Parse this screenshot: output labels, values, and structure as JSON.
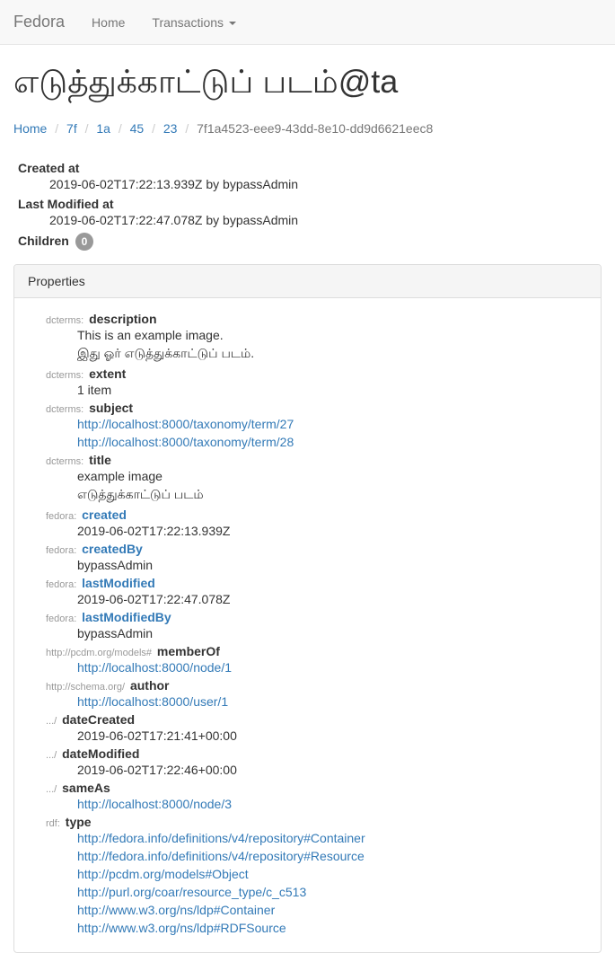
{
  "navbar": {
    "brand": "Fedora",
    "home": "Home",
    "transactions": "Transactions"
  },
  "page_title": "எடுத்துக்காட்டுப் படம்@ta",
  "breadcrumb": {
    "home": "Home",
    "seg1": "7f",
    "seg2": "1a",
    "seg3": "45",
    "seg4": "23",
    "active": "7f1a4523-eee9-43dd-8e10-dd9d6621eec8"
  },
  "meta": {
    "created_label": "Created at",
    "created_value": "2019-06-02T17:22:13.939Z by bypassAdmin",
    "modified_label": "Last Modified at",
    "modified_value": "2019-06-02T17:22:47.078Z by bypassAdmin",
    "children_label": "Children",
    "children_count": "0"
  },
  "panel": {
    "heading": "Properties"
  },
  "props": {
    "description": {
      "prefix": "dcterms:",
      "name": "description",
      "v1": "This is an example image.",
      "v2": "இது ஓர் எடுத்துக்காட்டுப் படம்."
    },
    "extent": {
      "prefix": "dcterms:",
      "name": "extent",
      "v1": "1 item"
    },
    "subject": {
      "prefix": "dcterms:",
      "name": "subject",
      "v1": "http://localhost:8000/taxonomy/term/27",
      "v2": "http://localhost:8000/taxonomy/term/28"
    },
    "title": {
      "prefix": "dcterms:",
      "name": "title",
      "v1": "example image",
      "v2": "எடுத்துக்காட்டுப் படம்"
    },
    "created": {
      "prefix": "fedora:",
      "name": "created",
      "v1": "2019-06-02T17:22:13.939Z"
    },
    "createdBy": {
      "prefix": "fedora:",
      "name": "createdBy",
      "v1": "bypassAdmin"
    },
    "lastModified": {
      "prefix": "fedora:",
      "name": "lastModified",
      "v1": "2019-06-02T17:22:47.078Z"
    },
    "lastModifiedBy": {
      "prefix": "fedora:",
      "name": "lastModifiedBy",
      "v1": "bypassAdmin"
    },
    "memberOf": {
      "prefix": "http://pcdm.org/models#",
      "name": "memberOf",
      "v1": "http://localhost:8000/node/1"
    },
    "author": {
      "prefix": "http://schema.org/",
      "name": "author",
      "v1": "http://localhost:8000/user/1"
    },
    "dateCreated": {
      "prefix": ".../",
      "name": "dateCreated",
      "v1": "2019-06-02T17:21:41+00:00"
    },
    "dateModified": {
      "prefix": ".../",
      "name": "dateModified",
      "v1": "2019-06-02T17:22:46+00:00"
    },
    "sameAs": {
      "prefix": ".../",
      "name": "sameAs",
      "v1": "http://localhost:8000/node/3"
    },
    "type": {
      "prefix": "rdf:",
      "name": "type",
      "v1": "http://fedora.info/definitions/v4/repository#Container",
      "v2": "http://fedora.info/definitions/v4/repository#Resource",
      "v3": "http://pcdm.org/models#Object",
      "v4": "http://purl.org/coar/resource_type/c_c513",
      "v5": "http://www.w3.org/ns/ldp#Container",
      "v6": "http://www.w3.org/ns/ldp#RDFSource"
    }
  }
}
